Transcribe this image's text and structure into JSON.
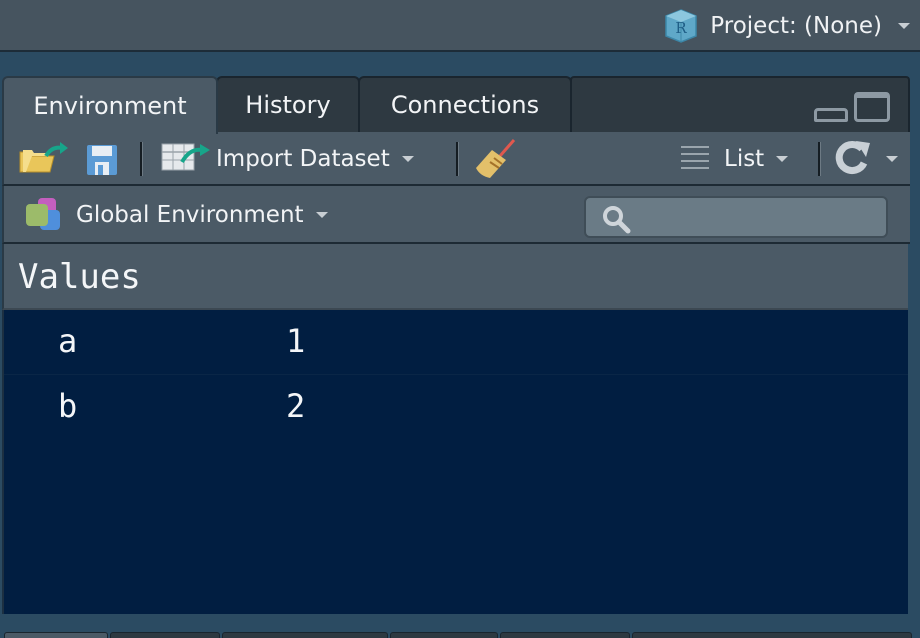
{
  "header": {
    "project_label": "Project: (None)",
    "project_icon": "r-project-icon"
  },
  "tabs": [
    {
      "label": "Environment",
      "active": true
    },
    {
      "label": "History",
      "active": false
    },
    {
      "label": "Connections",
      "active": false
    }
  ],
  "toolbar": {
    "open_icon": "open-folder-icon",
    "save_icon": "save-disk-icon",
    "import_label": "Import Dataset",
    "broom_icon": "broom-icon",
    "view_label": "List",
    "refresh_icon": "refresh-icon"
  },
  "environment": {
    "selector_label": "Global Environment",
    "search_placeholder": "",
    "search_value": ""
  },
  "values": {
    "section_label": "Values",
    "rows": [
      {
        "name": "a",
        "value": "1"
      },
      {
        "name": "b",
        "value": "2"
      }
    ]
  },
  "colors": {
    "panel_bg": "#011e41",
    "toolbar_bg": "#4b5a66",
    "outer_bg": "#2b4b62"
  }
}
